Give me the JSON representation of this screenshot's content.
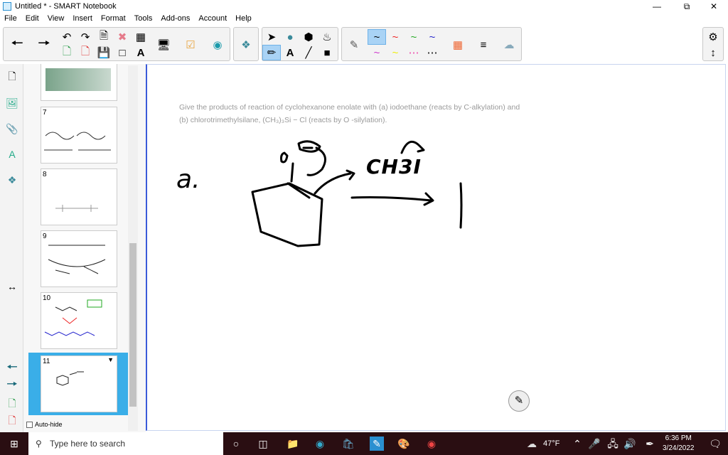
{
  "window": {
    "title": "Untitled * - SMART Notebook"
  },
  "menu": [
    "File",
    "Edit",
    "View",
    "Insert",
    "Format",
    "Tools",
    "Add-ons",
    "Account",
    "Help"
  ],
  "sorter": {
    "pages": [
      "7",
      "8",
      "9",
      "10",
      "11"
    ],
    "autohide_label": "Auto-hide"
  },
  "canvas": {
    "question_line1": "Give the products of reaction of cyclohexanone enolate with (a) iodoethane (reacts by C-alkylation) and",
    "question_line2": "(b) chlorotrimethylsilane, (CH₃)₃Si − Cl (reacts by O -silylation).",
    "handwriting_label": "a.",
    "handwriting_reagent": "CH3I"
  },
  "taskbar": {
    "search_placeholder": "Type here to search",
    "weather": "47°F",
    "time": "6:36 PM",
    "date": "3/24/2022"
  },
  "colors": {
    "accent": "#3b5bd9",
    "taskbar": "#2a0e12",
    "selected": "#a9d3f5"
  }
}
